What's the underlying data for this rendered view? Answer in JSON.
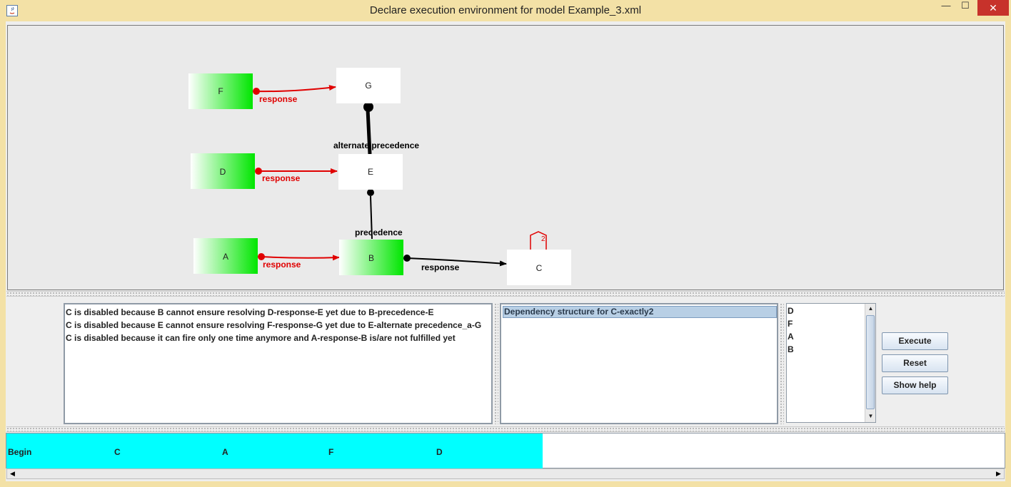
{
  "window": {
    "title": "Declare execution environment for model Example_3.xml",
    "close_glyph": "✕",
    "minimize_glyph": "—",
    "maximize_glyph": "☐"
  },
  "graph": {
    "nodes": {
      "F": "F",
      "G": "G",
      "D": "D",
      "E": "E",
      "A": "A",
      "B": "B",
      "C": "C"
    },
    "edge_labels": {
      "f_g": "response",
      "d_e": "response",
      "a_b": "response",
      "b_c": "response",
      "e_g": "alternate precedence",
      "b_e": "precedence"
    },
    "c_exactly_label": "2",
    "colors": {
      "enabled_gradient_start": "#ffffff",
      "enabled_gradient_end": "#00e600",
      "violated_edge": "#e00000",
      "satisfied_edge": "#000000"
    }
  },
  "reasons": [
    "C is disabled because  B cannot ensure resolving D-response-E yet due to B-precedence-E",
    "C is disabled because  E cannot ensure resolving F-response-G yet due to E-alternate precedence_a-G",
    "C is disabled because it can fire only one time anymore and  A-response-B  is/are not fulfilled yet"
  ],
  "dependency": {
    "header": "Dependency structure for C-exactly2"
  },
  "events": [
    "D",
    "F",
    "A",
    "B"
  ],
  "buttons": {
    "execute": "Execute",
    "reset": "Reset",
    "help": "Show help"
  },
  "trace": {
    "items": [
      "Begin",
      "C",
      "A",
      "F",
      "D"
    ],
    "highlight_color": "#00ffff"
  }
}
